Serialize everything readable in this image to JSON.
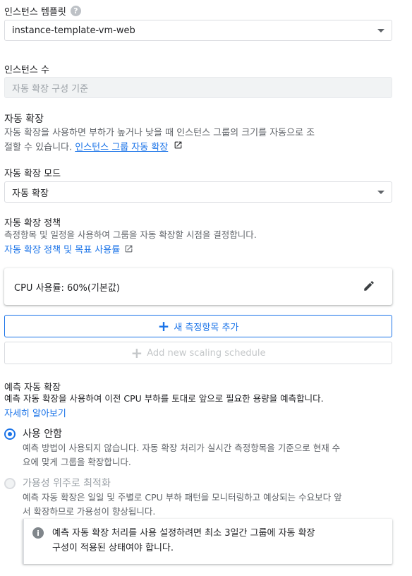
{
  "template": {
    "label": "인스턴스 템플릿",
    "value": "instance-template-vm-web"
  },
  "instances": {
    "label": "인스턴스 수",
    "placeholder": "자동 확장 구성 기준"
  },
  "autoscaling": {
    "title": "자동 확장",
    "description": "자동 확장을 사용하면 부하가 높거나 낮을 때 인스턴스 그룹의 크기를 자동으로 조",
    "description_cont": "절할 수 있습니다.",
    "link": "인스턴스 그룹 자동 확장"
  },
  "mode": {
    "label": "자동 확장 모드",
    "value": "자동 확장"
  },
  "policy": {
    "title": "자동 확장 정책",
    "description": "측정항목 및 일정을 사용하여 그룹을 자동 확장할 시점을 결정합니다.",
    "link": "자동 확장 정책 및 목표 사용률"
  },
  "metric_card": {
    "label": "CPU 사용률: 60%(기본값)"
  },
  "add_metric_button": "새 측정항목 추가",
  "add_schedule_button": "Add new scaling schedule",
  "predictive": {
    "title": "예측 자동 확장",
    "description": "예측 자동 확장을 사용하여 이전 CPU 부하를 토대로 앞으로 필요한 용량을 예측합니다.",
    "learn_more": "자세히 알아보기",
    "options": [
      {
        "label": "사용 안함",
        "desc1": "예측 방법이 사용되지 않습니다. 자동 확장 처리가 실시간 측정항목을 기준으로 현재 수",
        "desc2": "요에 맞게 그룹을 확장합니다.",
        "selected": true
      },
      {
        "label": "가용성 위주로 최적화",
        "desc1": "예측 자동 확장은 일일 및 주별로 CPU 부하 패턴을 모니터링하고 예상되는 수요보다 앞",
        "desc2": "서 확장하므로 가용성이 향상됩니다.",
        "selected": false
      }
    ],
    "info_line1": "예측 자동 확장 처리를 사용 설정하려면 최소 3일간 그룹에 자동 확장",
    "info_line2": "구성이 적용된 상태여야 합니다."
  },
  "colors": {
    "accent": "#1a73e8",
    "text": "#202124",
    "muted": "#5f6368",
    "border": "#dadce0",
    "disabled": "#c4c7c9"
  }
}
